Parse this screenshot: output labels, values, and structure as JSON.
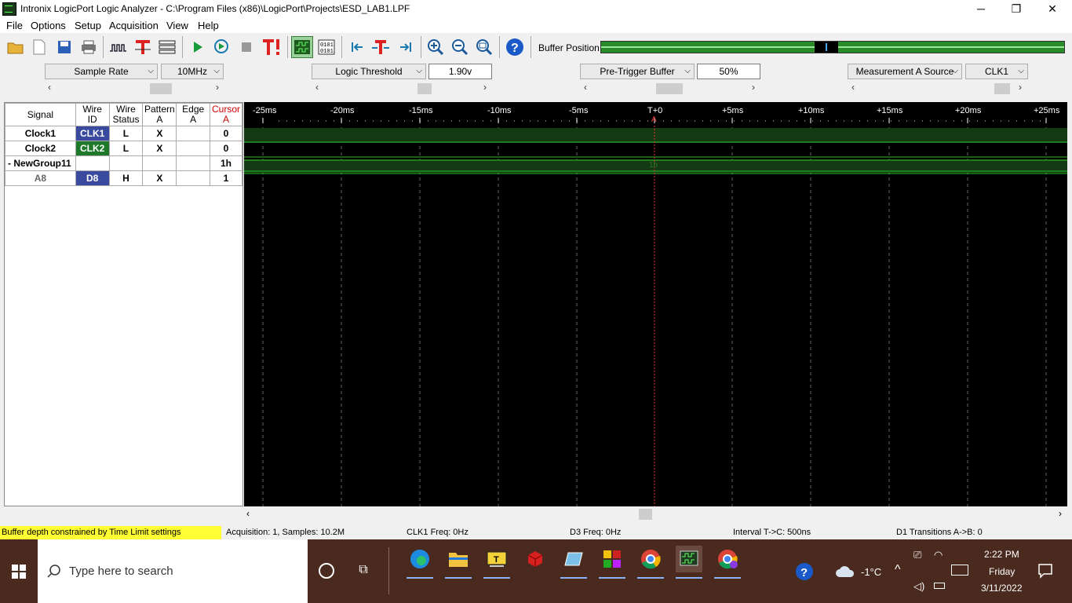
{
  "window": {
    "title": "Intronix LogicPort Logic Analyzer - C:\\Program Files (x86)\\LogicPort\\Projects\\ESD_LAB1.LPF",
    "minimize": "─",
    "maximize": "❐",
    "close": "✕"
  },
  "menu": [
    "File",
    "Options",
    "Setup",
    "Acquisition",
    "View",
    "Help"
  ],
  "toolbar": {
    "buffer_label": "Buffer Position:"
  },
  "controls": {
    "sample_rate_label": "Sample Rate",
    "sample_rate_value": "10MHz",
    "threshold_label": "Logic Threshold",
    "threshold_value": "1.90v",
    "pretrigger_label": "Pre-Trigger Buffer",
    "pretrigger_value": "50%",
    "measurement_label": "Measurement A Source",
    "measurement_value": "CLK1",
    "left_arrow": "‹",
    "right_arrow": "›"
  },
  "signal_table": {
    "headers": {
      "signal": "Signal",
      "wire_id_1": "Wire",
      "wire_id_2": "ID",
      "wire_status_1": "Wire",
      "wire_status_2": "Status",
      "pattern_1": "Pattern",
      "pattern_2": "A",
      "edge_1": "Edge",
      "edge_2": "A",
      "cursor_1": "Cursor",
      "cursor_2": "A"
    },
    "rows": [
      {
        "signal": "Clock1",
        "wire_id": "CLK1",
        "status": "L",
        "pattern": "X",
        "edge": "",
        "cursor": "0",
        "color": "#3a4a9e"
      },
      {
        "signal": "Clock2",
        "wire_id": "CLK2",
        "status": "L",
        "pattern": "X",
        "edge": "",
        "cursor": "0",
        "color": "#1e7a2a"
      },
      {
        "signal": "- NewGroup11",
        "wire_id": "",
        "status": "",
        "pattern": "",
        "edge": "",
        "cursor": "1h",
        "color": ""
      },
      {
        "signal": "A8",
        "wire_id": "D8",
        "status": "H",
        "pattern": "X",
        "edge": "",
        "cursor": "1",
        "color": "#3a4a9e"
      }
    ]
  },
  "waveform": {
    "ticks": [
      "-25ms",
      "-20ms",
      "-15ms",
      "-10ms",
      "-5ms",
      "T+0",
      "+5ms",
      "+10ms",
      "+15ms",
      "+20ms",
      "+25ms"
    ],
    "cursor_label": "A",
    "group_value": "1h"
  },
  "status": {
    "warning": "Buffer depth constrained by Time Limit settings",
    "acquisition": "Acquisition: 1, Samples: 10.2M",
    "clk1_freq": "CLK1 Freq: 0Hz",
    "d3_freq": "D3 Freq: 0Hz",
    "interval": "Interval T->C: 500ns",
    "transitions": "D1 Transitions A->B: 0"
  },
  "taskbar": {
    "search_placeholder": "Type here to search",
    "weather": "-1°C",
    "time": "2:22 PM",
    "day": "Friday",
    "date": "3/11/2022"
  },
  "colors": {
    "accent_green": "#1e7a2a",
    "wave_green": "#29c229",
    "warning_yellow": "#ffff33",
    "taskbar": "#4a2a1f"
  }
}
